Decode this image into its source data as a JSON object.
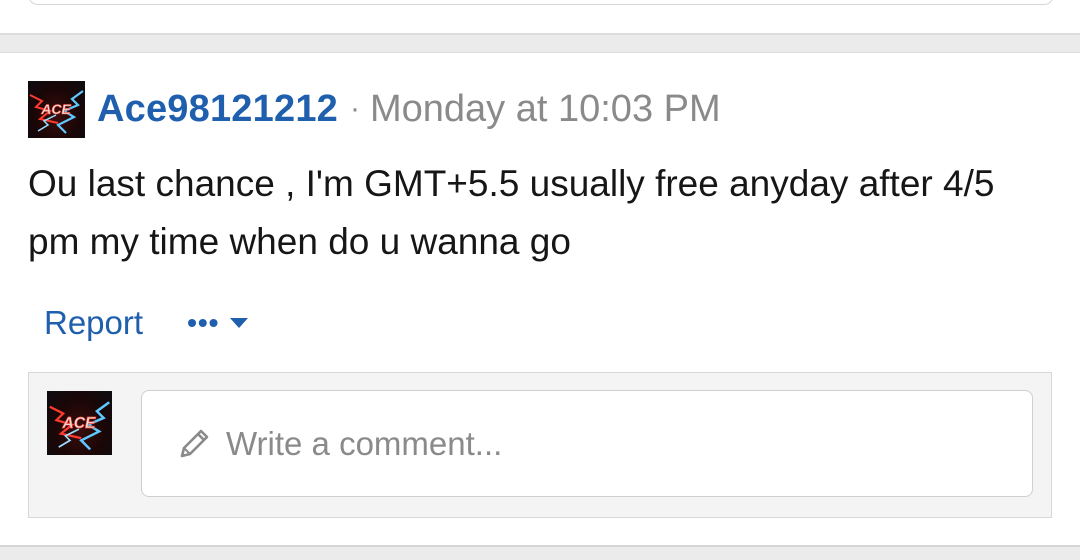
{
  "post": {
    "author": "Ace98121212",
    "separator": "·",
    "timestamp": "Monday at 10:03 PM",
    "body": "Ou last chance , I'm GMT+5.5 usually free anyday after 4/5 pm my time when do u wanna go"
  },
  "actions": {
    "report_label": "Report",
    "more_label": "•••",
    "more_icon": "caret-down-icon"
  },
  "comment": {
    "placeholder": "Write a comment...",
    "icon": "pencil-icon"
  },
  "colors": {
    "link": "#1f5fad",
    "muted": "#8a8a8a",
    "text": "#161616",
    "page_bg": "#ebebeb"
  }
}
